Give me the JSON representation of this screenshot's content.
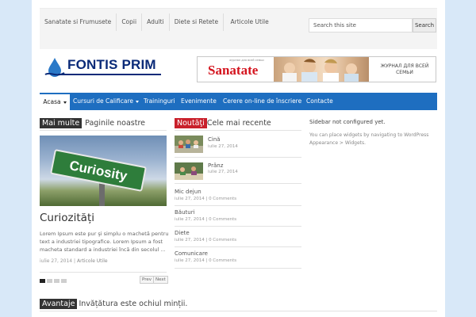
{
  "top_links": [
    "Sanatate si Frumusete",
    "Copii",
    "Adulti",
    "Diete si Retete",
    "Articole Utile"
  ],
  "search": {
    "placeholder": "Search this site",
    "button": "Search"
  },
  "logo": {
    "text": "FONTIS PRIM"
  },
  "banner": {
    "title": "Sanatate",
    "small": "журнал для всей семьи",
    "tagline": "ЖУРНАЛ ДЛЯ ВСЕЙ СЕМЬИ"
  },
  "nav": {
    "items": [
      "Acasa",
      "Cursuri de Calificare",
      "Traininguri",
      "Evenimente",
      "Cerere on-line de înscriere",
      "Contacte"
    ]
  },
  "section_pages": {
    "tag": "Mai multe",
    "title": "Paginile noastre"
  },
  "featured": {
    "image_text": "Curiosity",
    "title": "Curiozități",
    "excerpt": "Lorem Ipsum este pur şi simplu o machetă pentru text a industriei tipografice. Lorem Ipsum a fost macheta standard a industriei încă din secolul ...",
    "date": "iulie 27, 2014",
    "category": "Articole Utile"
  },
  "pager": {
    "prev": "Prev",
    "next": "Next"
  },
  "section_news": {
    "tag": "Noutăţi",
    "title": "Cele mai recente"
  },
  "news": [
    {
      "title": "Cină",
      "date": "iulie 27, 2014",
      "comments": ""
    },
    {
      "title": "Prânz",
      "date": "iulie 27, 2014",
      "comments": ""
    },
    {
      "title": "Mic dejun",
      "date": "iulie 27, 2014",
      "comments": "0 Comments"
    },
    {
      "title": "Băuturi",
      "date": "iulie 27, 2014",
      "comments": "0 Comments"
    },
    {
      "title": "Diete",
      "date": "iulie 27, 2014",
      "comments": "0 Comments"
    },
    {
      "title": "Comunicare",
      "date": "iulie 27, 2014",
      "comments": "0 Comments"
    }
  ],
  "sidebar": {
    "title": "Sidebar not configured yet.",
    "text": "You can place widgets by navigating to WordPress Appearance > Widgets."
  },
  "section_bottom": {
    "tag": "Avantaje",
    "title": "Invățătura este ochiul minții."
  },
  "colors": {
    "nav": "#1e6ec0",
    "logo": "#0a2a78",
    "red_tag": "#c9202b",
    "banner_red": "#d4141e"
  }
}
